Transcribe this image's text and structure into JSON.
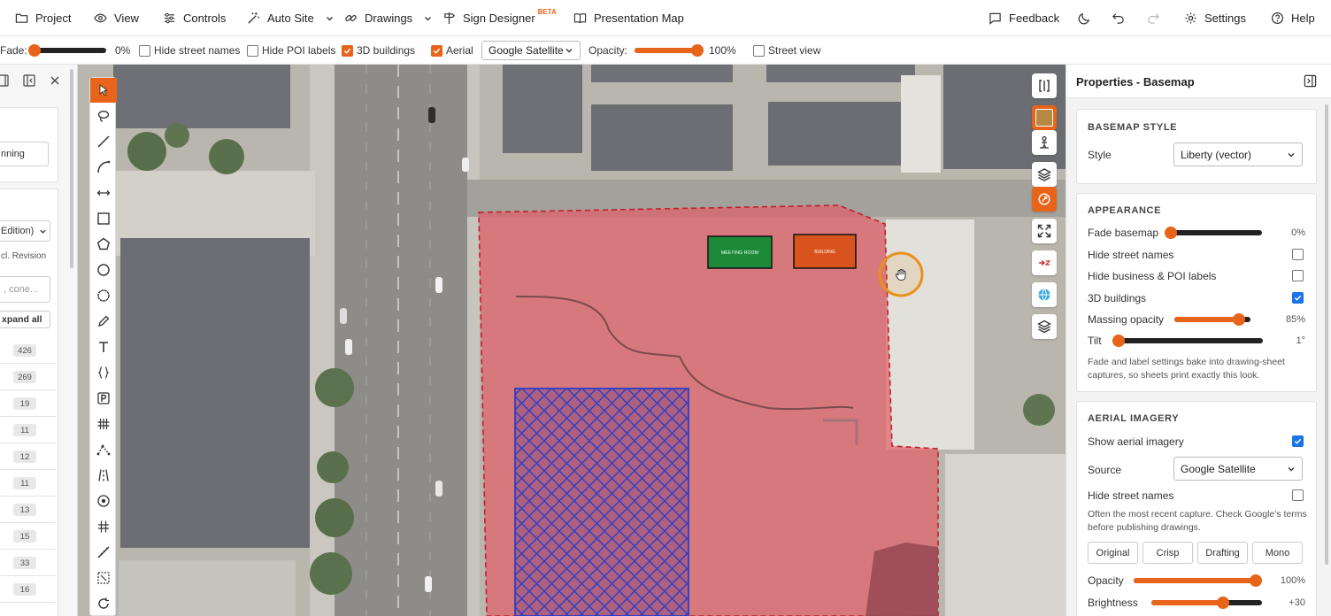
{
  "menu": {
    "project": "Project",
    "view": "View",
    "controls": "Controls",
    "auto_site": "Auto Site",
    "drawings": "Drawings",
    "sign_designer": "Sign Designer",
    "sign_designer_badge": "BETA",
    "presentation_map": "Presentation Map",
    "feedback": "Feedback",
    "settings": "Settings",
    "help": "Help"
  },
  "toolbar": {
    "fade_label": "Fade:",
    "fade_value": "0%",
    "fade_level": 0,
    "hide_street_names": "Hide street names",
    "hide_street_names_checked": false,
    "hide_poi_labels": "Hide POI labels",
    "hide_poi_labels_checked": false,
    "buildings_3d": "3D buildings",
    "buildings_3d_checked": true,
    "aerial": "Aerial",
    "aerial_checked": true,
    "source_select": "Google Satellite",
    "opacity_label": "Opacity:",
    "opacity_value": "100%",
    "opacity_level": 100,
    "street_view": "Street view",
    "street_view_checked": false
  },
  "left_panel": {
    "field_text": "nning",
    "select_text": "Edition)",
    "sub_text": "cl. Revision",
    "search_placeholder": ", cone...",
    "expand_all": "xpand all",
    "counts": [
      "426",
      "269",
      "19",
      "11",
      "12",
      "11",
      "13",
      "15",
      "33",
      "16"
    ]
  },
  "map": {
    "label_green": "MEETING ROOM",
    "label_orange": "BUILDING",
    "colors": {
      "site_fill": "#e0606a",
      "site_stroke": "#c0202a",
      "hatch": "#2a3ec8",
      "green_box": "#1d8a3a",
      "orange_box": "#d9531e",
      "cursor_ring": "#e8901b"
    }
  },
  "properties": {
    "title": "Properties - Basemap",
    "basemap_style": {
      "title": "BASEMAP STYLE",
      "style_label": "Style",
      "style_value": "Liberty (vector)"
    },
    "appearance": {
      "title": "APPEARANCE",
      "fade_basemap": "Fade basemap",
      "fade_value": "0%",
      "fade_level": 0,
      "hide_street_names": "Hide street names",
      "hide_street_names_checked": false,
      "hide_poi_labels": "Hide business & POI labels",
      "hide_poi_labels_checked": false,
      "buildings_3d": "3D buildings",
      "buildings_3d_checked": true,
      "massing_opacity": "Massing opacity",
      "massing_value": "85%",
      "massing_level": 85,
      "tilt": "Tilt",
      "tilt_value": "1°",
      "tilt_level": 1,
      "note": "Fade and label settings bake into drawing-sheet captures, so sheets print exactly this look."
    },
    "aerial": {
      "title": "AERIAL IMAGERY",
      "show_aerial": "Show aerial imagery",
      "show_aerial_checked": true,
      "source_label": "Source",
      "source_value": "Google Satellite",
      "hide_street_names": "Hide street names",
      "hide_street_names_checked": false,
      "note": "Often the most recent capture. Check Google's terms before publishing drawings.",
      "presets": [
        "Original",
        "Crisp",
        "Drafting",
        "Mono"
      ],
      "opacity_label": "Opacity",
      "opacity_value": "100%",
      "opacity_level": 100,
      "brightness_label": "Brightness",
      "brightness_value": "+30",
      "brightness_level": 65
    }
  }
}
